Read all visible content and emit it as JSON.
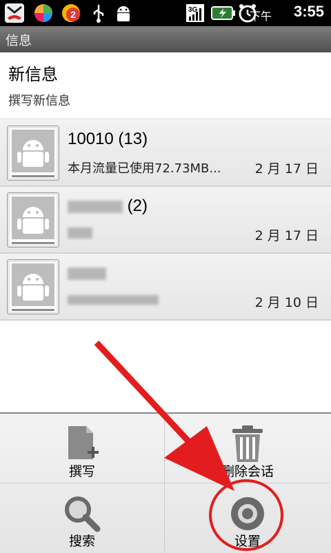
{
  "status_bar": {
    "ampm": "下午",
    "time": "3:55",
    "badge_count": "2",
    "network": "3G"
  },
  "header": {
    "title": "信息"
  },
  "new_message": {
    "title": "新信息",
    "subtitle": "撰写新信息"
  },
  "conversations": [
    {
      "name": "10010 (13)",
      "snippet": "本月流量已使用72.73MB...",
      "date": "2 月 17 日"
    },
    {
      "name_suffix": "(2)",
      "date": "2 月 17 日"
    },
    {
      "date": "2 月 10 日"
    }
  ],
  "menu": {
    "items": [
      {
        "label": "撰写",
        "icon": "compose-icon"
      },
      {
        "label": "删除会话",
        "icon": "trash-icon"
      },
      {
        "label": "搜索",
        "icon": "search-icon"
      },
      {
        "label": "设置",
        "icon": "settings-icon"
      }
    ]
  },
  "colors": {
    "annotation": "#e31d1d"
  }
}
